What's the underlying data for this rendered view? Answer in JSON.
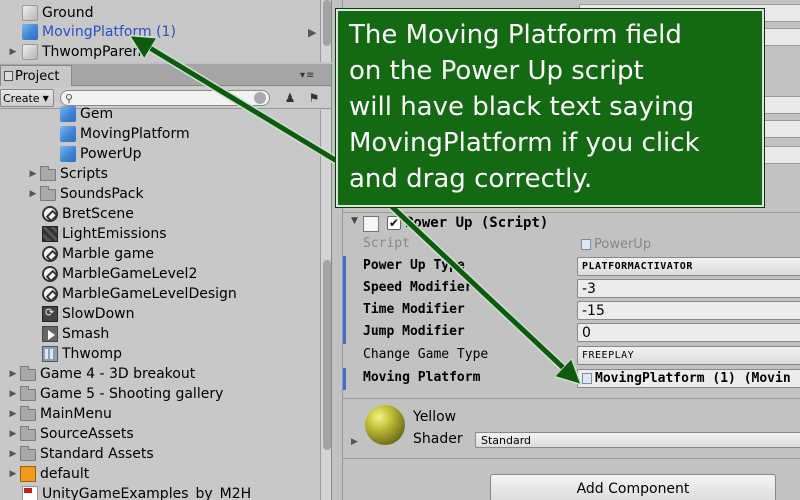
{
  "hierarchy": {
    "items": [
      {
        "label": "Ground",
        "icon": "cube-grey-icon",
        "selected": false
      },
      {
        "label": "MovingPlatform (1)",
        "icon": "cube-blue-icon",
        "selected": true
      },
      {
        "label": "ThwompParent",
        "icon": "cube-grey-icon",
        "selected": false
      }
    ]
  },
  "project": {
    "tab_label": "Project",
    "create_label": "Create",
    "search_placeholder": "",
    "items": [
      {
        "label": "Gem",
        "icon": "prefab-icon"
      },
      {
        "label": "MovingPlatform",
        "icon": "prefab-icon"
      },
      {
        "label": "PowerUp",
        "icon": "prefab-icon"
      },
      {
        "label": "Scripts",
        "icon": "folder-icon"
      },
      {
        "label": "SoundsPack",
        "icon": "folder-icon"
      },
      {
        "label": "BretScene",
        "icon": "unity-scene-icon"
      },
      {
        "label": "LightEmissions",
        "icon": "lighting-icon"
      },
      {
        "label": "Marble game",
        "icon": "unity-scene-icon"
      },
      {
        "label": "MarbleGameLevel2",
        "icon": "unity-scene-icon"
      },
      {
        "label": "MarbleGameLevelDesign",
        "icon": "unity-scene-icon"
      },
      {
        "label": "SlowDown",
        "icon": "script-icon"
      },
      {
        "label": "Smash",
        "icon": "animation-icon"
      },
      {
        "label": "Thwomp",
        "icon": "grid-icon"
      },
      {
        "label": "Game 4 - 3D breakout",
        "icon": "folder-icon"
      },
      {
        "label": "Game 5 - Shooting gallery",
        "icon": "folder-icon"
      },
      {
        "label": "MainMenu",
        "icon": "folder-icon"
      },
      {
        "label": "SourceAssets",
        "icon": "folder-icon"
      },
      {
        "label": "Standard Assets",
        "icon": "folder-icon"
      },
      {
        "label": "default",
        "icon": "package-icon"
      },
      {
        "label": "UnityGameExamples_by_M2H",
        "icon": "pdf-icon"
      }
    ]
  },
  "inspector": {
    "component_title": "Power Up (Script)",
    "component_enabled": true,
    "script": {
      "label": "Script",
      "value": "PowerUp"
    },
    "properties": [
      {
        "label": "Power Up Type",
        "value": "PLATFORMACTIVATOR"
      },
      {
        "label": "Speed Modifier",
        "value": "-3"
      },
      {
        "label": "Time Modifier",
        "value": "-15"
      },
      {
        "label": "Jump Modifier",
        "value": "0"
      },
      {
        "label": "Change Game Type",
        "value": "FREEPLAY"
      },
      {
        "label": "Moving Platform",
        "value": "MovingPlatform (1) (Movin"
      }
    ],
    "material": {
      "name": "Yellow",
      "shader_label": "Shader",
      "shader_value": "Standard"
    },
    "add_component_label": "Add Component"
  },
  "callout": {
    "text": "The Moving Platform field\non the Power Up script\nwill have black text saying\nMovingPlatform if you click\nand drag correctly.",
    "background": "#136a13",
    "text_color": "#ffffff"
  },
  "colors": {
    "selection_text": "#2b4fc4",
    "arrow": "#0e5a0e",
    "panel_bg": "#c2c2c2"
  }
}
